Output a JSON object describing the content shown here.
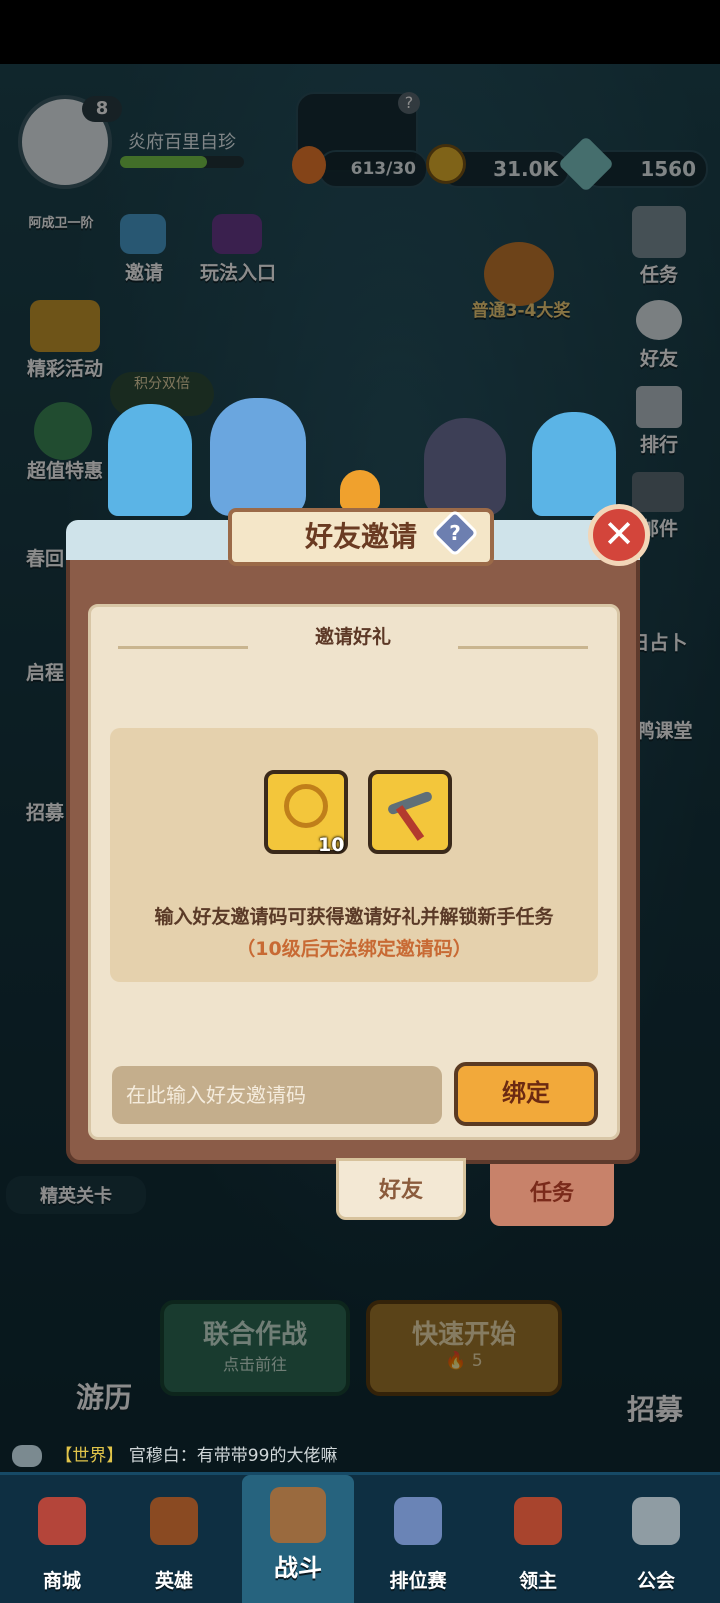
{
  "top": {
    "player_name": "炎府百里自珍",
    "level": "8",
    "level_progress": 0.7,
    "stamina": "613/30",
    "gold": "31.0K",
    "gems": "1560",
    "help_badge": "?"
  },
  "left_menu": [
    {
      "label": "阿成卫一阶"
    },
    {
      "label": "邀请"
    },
    {
      "label": "玩法入口"
    },
    {
      "label": "精彩活动"
    },
    {
      "label": "积分双倍"
    },
    {
      "label": "超值特惠"
    },
    {
      "label": "春回"
    },
    {
      "label": "启程"
    },
    {
      "label": "招募"
    },
    {
      "label": "精英关卡"
    }
  ],
  "right_menu": [
    {
      "label": "任务"
    },
    {
      "label": "好友"
    },
    {
      "label": "排行"
    },
    {
      "label": "邮件"
    },
    {
      "label": "日占卜"
    },
    {
      "label": "鸭课堂"
    }
  ],
  "event_badge": "普通3-4大奖",
  "dialog": {
    "title": "好友邀请",
    "help": "?",
    "close": "✕",
    "section_title": "邀请好礼",
    "rewards": [
      {
        "icon": "gold-key-icon",
        "qty": "10"
      },
      {
        "icon": "pickaxe-icon",
        "qty": ""
      }
    ],
    "description": "输入好友邀请码可获得邀请好礼并解锁新手任务",
    "note": "（10级后无法绑定邀请码）",
    "input_placeholder": "在此输入好友邀请码",
    "bind_label": "绑定",
    "tabs": [
      {
        "label": "好友",
        "active": true
      },
      {
        "label": "任务",
        "active": false
      }
    ]
  },
  "battle": {
    "coop_title": "联合作战",
    "coop_sub": "点击前往",
    "quick_title": "快速开始",
    "quick_cost": "5",
    "travel": "游历",
    "recruit": "招募"
  },
  "chat": {
    "channel": "【世界】",
    "message": "官穆白：有带带99的大佬嘛"
  },
  "nav": [
    {
      "label": "商城"
    },
    {
      "label": "英雄"
    },
    {
      "label": "战斗"
    },
    {
      "label": "排位赛"
    },
    {
      "label": "领主"
    },
    {
      "label": "公会"
    }
  ],
  "colors": {
    "accent_orange": "#f2a93a",
    "note_orange": "#c86a34",
    "close_red": "#d3453b",
    "nav_bg": "#0e2f42"
  }
}
